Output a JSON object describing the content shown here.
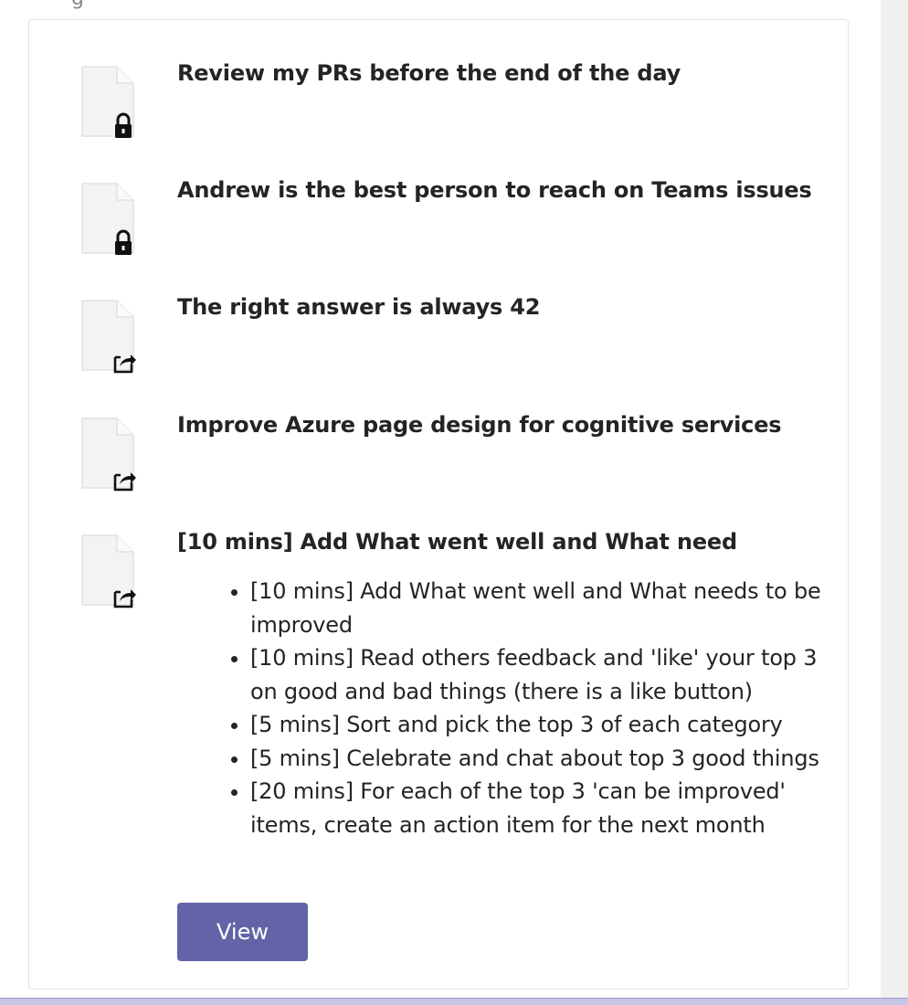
{
  "top_partial_text": "g",
  "items": [
    {
      "title": "Review my PRs before the end of the day",
      "icon": "locked-document-icon"
    },
    {
      "title": "Andrew is the best person to reach on Teams issues",
      "icon": "locked-document-icon"
    },
    {
      "title": "The right answer is always 42",
      "icon": "shared-document-icon"
    },
    {
      "title": "Improve Azure page design for cognitive services",
      "icon": "shared-document-icon"
    },
    {
      "title": "[10 mins] Add What went well and What need",
      "icon": "shared-document-icon",
      "bullets": [
        "[10 mins] Add What went well and What needs to be improved",
        "[10 mins] Read others feedback and 'like' your top 3 on good and bad things (there is a like button)",
        "[5 mins] Sort and pick the top 3 of each category",
        "[5 mins] Celebrate and chat about top 3 good things",
        "[20 mins] For each of the top 3 'can be improved' items, create an action item for the next month"
      ]
    }
  ],
  "view_button": {
    "label": "View"
  },
  "colors": {
    "accent": "#6264a7",
    "text": "#252423",
    "card_border": "#e7e6e5",
    "rail": "#f0f0f0"
  }
}
